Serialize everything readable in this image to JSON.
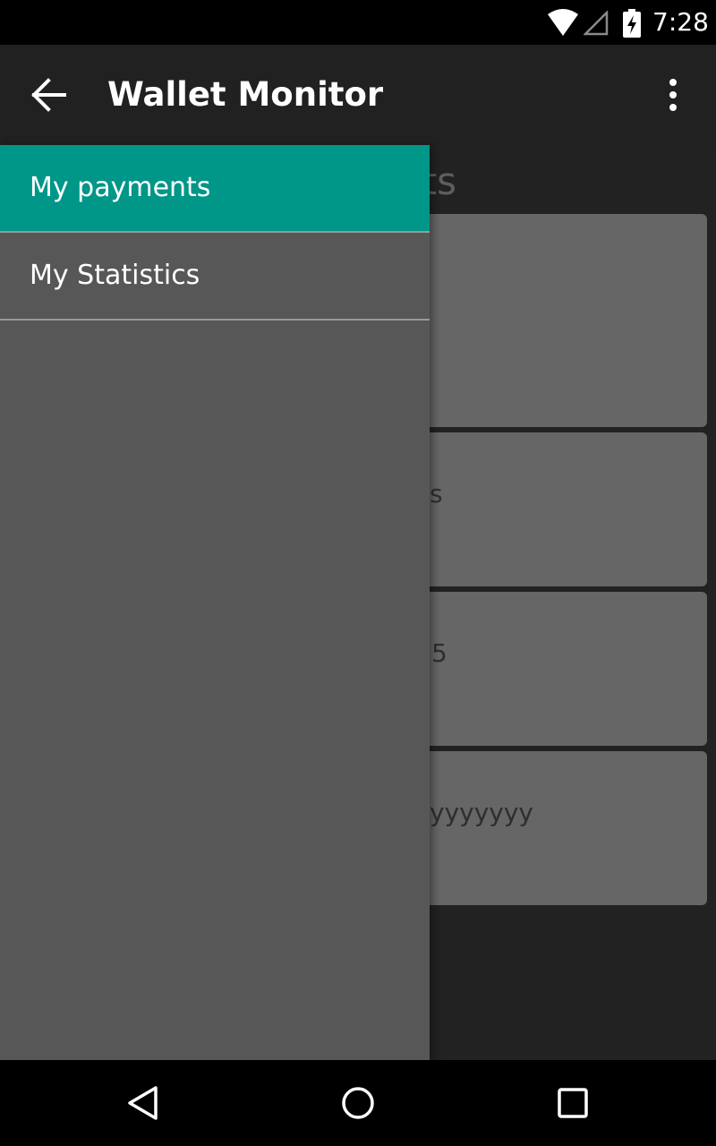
{
  "status_bar": {
    "time": "7:28",
    "icons": [
      "wifi-icon",
      "cell-signal-icon",
      "battery-charging-icon"
    ]
  },
  "app_bar": {
    "title": "Wallet Monitor",
    "back_icon": "arrow-back-icon",
    "menu_icon": "more-vert-icon"
  },
  "background": {
    "heading_partial": "ts",
    "cards": [
      {
        "text_partial": ""
      },
      {
        "text_partial": "s"
      },
      {
        "text_partial": "5"
      },
      {
        "text_partial": "yyyyyyy"
      }
    ]
  },
  "drawer": {
    "items": [
      {
        "label": "My payments",
        "active": true
      },
      {
        "label": "My Statistics",
        "active": false
      }
    ]
  },
  "nav_bar": {
    "icons": [
      "back-triangle-icon",
      "home-circle-icon",
      "recents-square-icon"
    ]
  },
  "colors": {
    "accent": "#009688",
    "app_bar": "#212121",
    "drawer": "#575757",
    "card": "#666666",
    "background": "#222222"
  }
}
